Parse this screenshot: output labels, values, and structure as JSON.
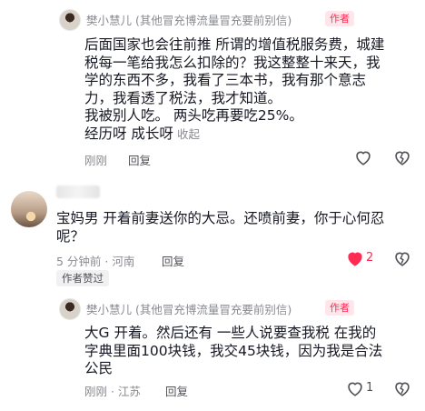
{
  "comments": [
    {
      "username": "樊小慧儿 (其他冒充博流量冒充要前别信)",
      "badge": "作者",
      "lines": [
        "后面国家也会往前推  所谓的增值税服务费，城建",
        "税每一笔给我怎么扣除的？我这整整十来天，我",
        "学的东西不多，我看了三本书，我有那个意志",
        "力，我看透了税法，我才知道。",
        "我被别人吃。 两头吃再要吃25%。",
        " 经历呀 成长呀"
      ],
      "collapse_label": "收起",
      "meta": "刚刚",
      "reply_label": "回复"
    },
    {
      "username": "",
      "lines": [
        "宝妈男 开着前妻送你的大忌。还喷前妻，你于心何忍",
        "呢？"
      ],
      "meta": "5 分钟前 · 河南",
      "reply_label": "回复",
      "like_count": "2",
      "liked": true,
      "author_liked_label": "作者赞过"
    },
    {
      "username": "樊小慧儿 (其他冒充博流量冒充要前别信)",
      "badge": "作者",
      "lines": [
        "大G 开着。然后还有 一些人说要查我税  在我的",
        "字典里面100块钱，我交45块钱，因为我是合法",
        "公民"
      ],
      "meta": "刚刚 · 江苏",
      "reply_label": "回复",
      "like_count": "1"
    }
  ],
  "icons": {
    "like": "heart-outline-icon",
    "liked": "heart-filled-icon",
    "dislike": "broken-heart-icon"
  },
  "colors": {
    "accent": "#fe2c55",
    "muted": "#8a8b91",
    "text": "#161823",
    "badge_bg": "#ffe6eb"
  }
}
